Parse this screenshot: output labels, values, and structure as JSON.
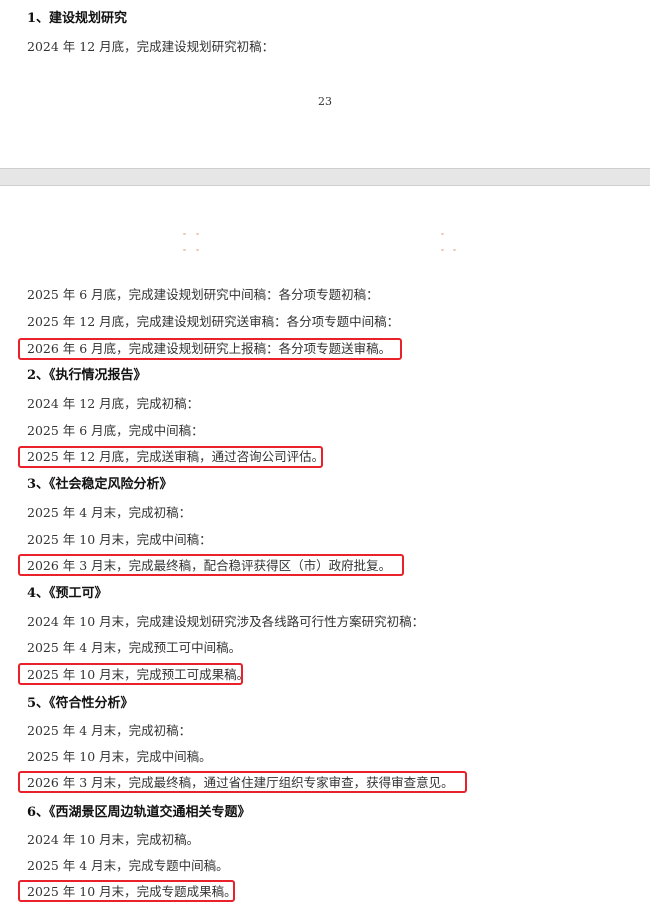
{
  "page1": {
    "heading": "1、建设规划研究",
    "lines": [
      "2024 年 12 月底，完成建设规划研究初稿："
    ],
    "page_number": "23"
  },
  "page2": {
    "sec1_lines": [
      "2025 年 6 月底，完成建设规划研究中间稿：各分项专题初稿：",
      "2025 年 12 月底，完成建设规划研究送审稿：各分项专题中间稿：",
      "2026 年 6 月底，完成建设规划研究上报稿：各分项专题送审稿。"
    ],
    "sec2": {
      "heading": "2、《执行情况报告》",
      "lines": [
        "2024 年 12 月底，完成初稿：",
        "2025 年 6 月底，完成中间稿：",
        "2025 年 12 月底，完成送审稿，通过咨询公司评估。"
      ]
    },
    "sec3": {
      "heading": "3、《社会稳定风险分析》",
      "lines": [
        "2025 年 4 月末，完成初稿：",
        "2025 年 10 月末，完成中间稿：",
        "2026 年 3 月末，完成最终稿，配合稳评获得区（市）政府批复。"
      ]
    },
    "sec4": {
      "heading": "4、《预工可》",
      "lines": [
        "2024 年 10 月末，完成建设规划研究涉及各线路可行性方案研究初稿：",
        "2025 年 4 月末，完成预工可中间稿。",
        "2025 年 10 月末，完成预工可成果稿。"
      ]
    },
    "sec5": {
      "heading": "5、《符合性分析》",
      "lines": [
        "2025 年 4 月末，完成初稿：",
        "2025 年 10 月末，完成中间稿。",
        "2026 年 3 月末，完成最终稿，通过省住建厅组织专家审查，获得审查意见。"
      ]
    },
    "sec6": {
      "heading": "6、《西湖景区周边轨道交通相关专题》",
      "lines": [
        "2024 年 10 月末，完成初稿。",
        "2025 年 4 月末，完成专题中间稿。",
        "2025 年 10 月末，完成专题成果稿。"
      ]
    }
  },
  "colors": {
    "highlight_border": "#e8212a",
    "page_gap": "#e6e6e6"
  }
}
